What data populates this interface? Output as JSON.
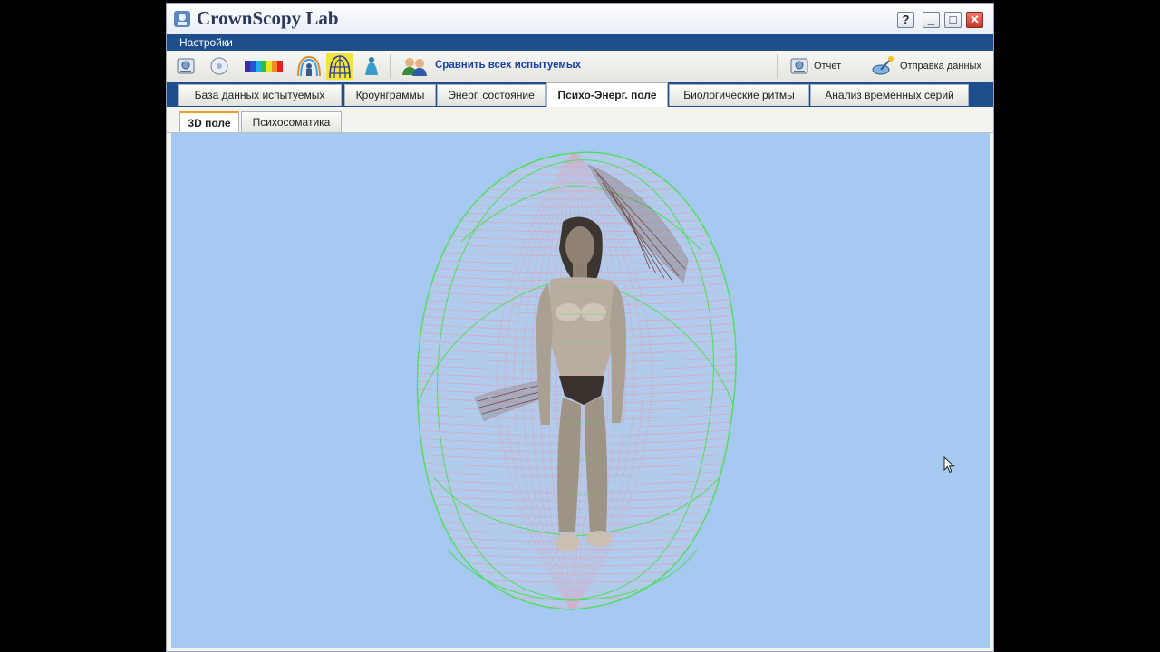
{
  "app": {
    "title": "CrownScopy Lab"
  },
  "window_controls": {
    "help": "?",
    "minimize": "_",
    "maximize": "□",
    "close": "✕"
  },
  "menu": {
    "settings": "Настройки"
  },
  "toolbar": {
    "compare_label": "Сравнить всех испытуемых",
    "report_label": "Отчет",
    "send_label": "Отправка данных",
    "icons": [
      "camera-icon",
      "disc-icon",
      "spectrum-icon",
      "aura-icon",
      "globe-grid-icon",
      "bell-figure-icon",
      "people-compare-icon",
      "report-icon",
      "satellite-icon"
    ]
  },
  "main_tabs": [
    {
      "label": "База данных испытуемых",
      "active": false
    },
    {
      "label": "Кроунграммы",
      "active": false
    },
    {
      "label": "Энерг. состояние",
      "active": false
    },
    {
      "label": "Психо-Энерг. поле",
      "active": true
    },
    {
      "label": "Биологические ритмы",
      "active": false
    },
    {
      "label": "Анализ временных серий",
      "active": false
    }
  ],
  "sub_tabs": [
    {
      "label": "3D поле",
      "active": true
    },
    {
      "label": "Психосоматика",
      "active": false
    }
  ],
  "colors": {
    "menubar": "#1e4f8c",
    "viewport_bg": "#a6c9f2",
    "field_green": "#44e04a",
    "field_pink": "#e8a6b8",
    "compare_text": "#1a3fa6"
  }
}
